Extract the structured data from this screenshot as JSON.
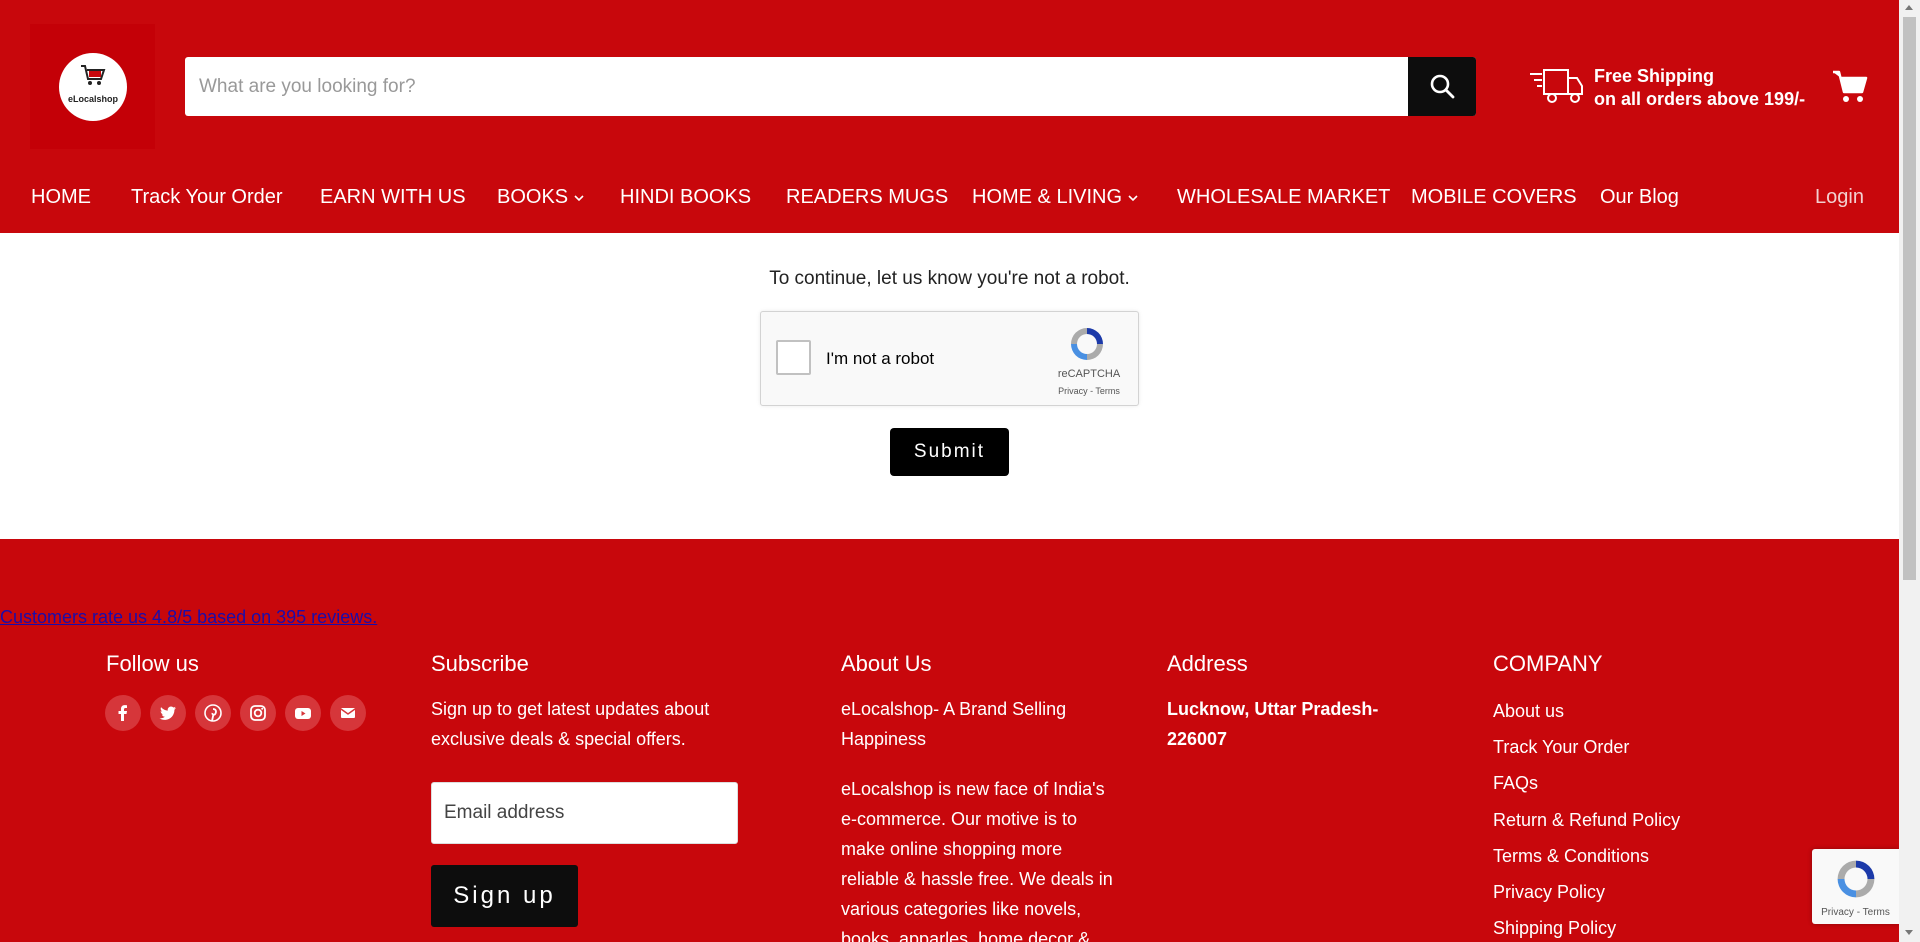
{
  "header": {
    "logo_text": "eLocalshop",
    "search": {
      "placeholder": "What are you looking for?",
      "value": ""
    },
    "shipping": {
      "line1": "Free Shipping",
      "line2": "on all orders above 199/-"
    }
  },
  "nav": {
    "items": [
      {
        "label": "HOME"
      },
      {
        "label": "Track Your Order"
      },
      {
        "label": "EARN WITH US"
      },
      {
        "label": "BOOKS",
        "has_dropdown": true
      },
      {
        "label": "HINDI BOOKS"
      },
      {
        "label": "READERS MUGS"
      },
      {
        "label": "HOME & LIVING",
        "has_dropdown": true
      },
      {
        "label": "WHOLESALE MARKET"
      },
      {
        "label": "MOBILE COVERS"
      },
      {
        "label": "Our Blog"
      }
    ],
    "login": "Login"
  },
  "captcha": {
    "prompt": "To continue, let us know you're not a robot.",
    "checkbox_label": "I'm not a robot",
    "brand": "reCAPTCHA",
    "links": "Privacy - Terms",
    "submit": "Submit"
  },
  "footer": {
    "reviews": "Customers rate us 4.8/5 based on 395 reviews.",
    "follow": {
      "heading": "Follow us",
      "icons": [
        "facebook-icon",
        "twitter-icon",
        "pinterest-icon",
        "instagram-icon",
        "youtube-icon",
        "email-icon"
      ]
    },
    "subscribe": {
      "heading": "Subscribe",
      "text": "Sign up to get latest updates about exclusive deals & special offers.",
      "email_placeholder": "Email address",
      "button": "Sign up"
    },
    "about": {
      "heading": "About Us",
      "tagline": "eLocalshop- A Brand Selling Happiness",
      "body": "eLocalshop is new face of India's e-commerce. Our motive is to make online shopping more reliable & hassle free. We deals in various categories like novels, books, apparles, home decor &"
    },
    "address": {
      "heading": "Address",
      "text": "Lucknow, Uttar Pradesh-226007"
    },
    "company": {
      "heading": "COMPANY",
      "links": [
        "About us",
        "Track Your Order",
        "FAQs",
        "Return & Refund Policy",
        "Terms & Conditions",
        "Privacy Policy",
        "Shipping Policy"
      ]
    }
  },
  "recaptcha_badge": {
    "text": "Privacy - Terms"
  },
  "colors": {
    "brand_red": "#c8070c",
    "button_black": "#0d0d0d",
    "link_blue": "#1a0dab"
  }
}
